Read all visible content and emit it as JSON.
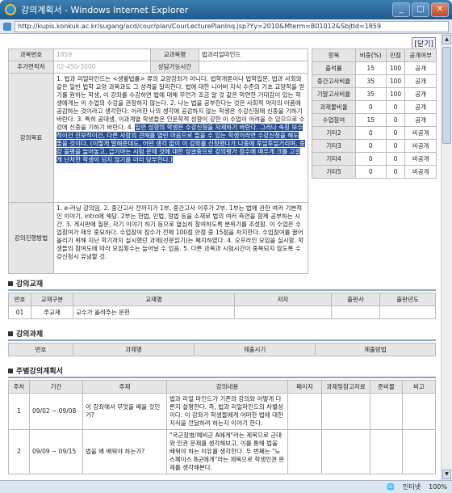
{
  "window": {
    "title": "강의계획서 - Windows Internet Explorer",
    "url": "http://kupis.konkuk.ac.kr/sugang/acd/cour/plan/CourLecturePlanInq.jsp?Yy=2010&Mterm=B01012&SbjtId=1859"
  },
  "close_label": "닫기",
  "info": {
    "subject_code_label": "과목번호",
    "subject_code": "1859",
    "course_name_label": "교과목명",
    "course_name": "법과리얼마인드",
    "contact_label": "추가연락처",
    "contact": "02-450-3000",
    "consult_label": "상담가능시간",
    "consult": "",
    "objective_label": "강의목표",
    "objective_text": "1. 법과 리얼마인드는 <생활법률> 류의 교양강좌가 아니다. 법학개론이나 법학입문, 법과 사회와 같은 일반 법학 교양 과목과도 그 성격을 달리한다. 법에 대한 니어버 지식 수준의 기초 교양학을 얻기를 원하는 학생, 이 강좌를 수강하면 법에 대해 무언가 조금 알 것 같은 막연한 기대감이 있는 학생에게는 이 수업의 수강을 권장하지 않는다. 2. 나는 법을 공부한다는 것은 사회적 약자의 아픔에 공감하는 것이라고 생각한다. 이러한 나의 생각에 공감하지 않는 학생은 수강신청에 신중을 기하기 바란다. 3. 특히 공대생, 이과계열 학생들은 인문학적 성향이 강한 이 수업이 어려울 수 있으므로 수강에 신중을 기하기 바란다. 4. ",
    "objective_hl": "일면 성향의 학생은 수강신청을 자제하기 바란다. 그러나 속칭 보수적이건 진보적이건, 다른 사람의 견해를 열린 마음으로 들을 수 있는 학생이라면 수강신청을 해도 좋을 것이다. (이렇게 말해준대도, 어떤 생각 없이 이 강좌를 신청했다가 나중에 투덜투덜거리며, 중강 불평을 늘어놓고, 급기야는 시험 문제 것에 대한 성글중으로 강의평가 점수에 매우게 크롤 고걸게 난처한 학생이 되지 않기를 미리 당부한다.)",
    "method_label": "강의진행방법",
    "method_text": "1. e-러닝 강의임. 2. 중간고사 전까지가 1부, 중간고사 이후가 2부. 1부는 법에 관한 여러 기본적인 이야기, intro에 해당. 2부는 헌법, 민법, 형법 등을 소재로 법의 여러 측면을 함께 공부하는 시간. 3. 게시판에 질문, 자기 이야기 하기 등으로 열심히 참여하도록 분위기를 조성함. 이 수업은 수업참여가 매우 중요하다. 수업참여 점수가 전체 100점 만점 중 15점을 차지한다. 수업참여를 끌어올리기 위해 지난 학기까지 실시했던 과제(선문읽기)는 폐지하였다. 4. 오프라인 모임을 실시함. 학생들의 참여도에 따라 모임횟수는 늘어날 수 있음. 5. 다른 과목과 시험시간이 중복되지 않도록 수강신청시 유념할 것."
  },
  "grades": {
    "headers": [
      "항목",
      "비중(%)",
      "만점",
      "공개여부"
    ],
    "rows": [
      [
        "출석률",
        "15",
        "100",
        "공개"
      ],
      [
        "중간고사비율",
        "35",
        "100",
        "공개"
      ],
      [
        "기말고사비율",
        "35",
        "100",
        "공개"
      ],
      [
        "과제물비율",
        "0",
        "0",
        "공개"
      ],
      [
        "수업참여",
        "15",
        "0",
        "공개"
      ],
      [
        "기타2",
        "0",
        "0",
        "비공개"
      ],
      [
        "기타3",
        "0",
        "0",
        "비공개"
      ],
      [
        "기타4",
        "0",
        "0",
        "비공개"
      ],
      [
        "기타5",
        "0",
        "0",
        "비공개"
      ]
    ]
  },
  "textbook": {
    "title": "강의교재",
    "headers": [
      "번호",
      "교재구분",
      "교재명",
      "저자",
      "출판사",
      "출판년도"
    ],
    "rows": [
      [
        "01",
        "주교재",
        "교수가 올려주는 문헌",
        "",
        "",
        ""
      ]
    ]
  },
  "assignment": {
    "title": "강의과제",
    "headers": [
      "번호",
      "과제명",
      "제출시기",
      "제출방법"
    ]
  },
  "weekly": {
    "title": "주별강의계획서",
    "headers": [
      "주차",
      "기간",
      "주제",
      "강의내용",
      "페이지",
      "과제및참고자료",
      "준비물",
      "비고"
    ],
    "rows": [
      [
        "1",
        "09/02 ~ 09/08",
        "이 강좌에서 무엇을 배울 것인가?",
        "법과 리얼 마인드가 기존의 강의와 어떻게 다른지 설명한다. 즉, 법과 리얼마인드의 차별성이다. 이 강좌가 학생들에게 어떠한 법에 대한 지식을 전달하려 하는지 이야기 한다.",
        "",
        "",
        "",
        ""
      ],
      [
        "2",
        "09/09 ~ 09/15",
        "법을 왜 배워야 하는가?",
        "\"국군장병/예비군 A에게\"라는 제목으로 군대와 인권 문제를 생각해보고, 이를 통해 법을 배워야 하는 이유를 생각한다. 두 번째는 \"노스페이스 B군에게\"라는 제목으로 학생인권 문제를 생각해본다.",
        "",
        "",
        "",
        ""
      ]
    ]
  },
  "status": {
    "zone": "인터넷",
    "zoom": "100%"
  }
}
